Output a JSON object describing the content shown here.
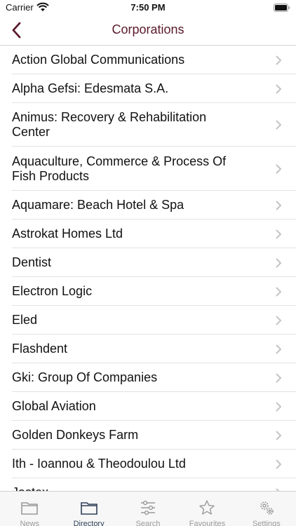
{
  "status_bar": {
    "carrier": "Carrier",
    "time": "7:50 PM"
  },
  "nav": {
    "title": "Corporations",
    "back_icon": "chevron-left-icon",
    "accent_color": "#5a1a2b"
  },
  "list": {
    "items": [
      {
        "label": "Action Global Communications"
      },
      {
        "label": "Alpha Gefsi: Edesmata S.A."
      },
      {
        "label": "Animus: Recovery & Rehabilitation Center"
      },
      {
        "label": "Aquaculture, Commerce & Process Of Fish Products"
      },
      {
        "label": "Aquamare: Beach Hotel & Spa"
      },
      {
        "label": "Astrokat Homes Ltd"
      },
      {
        "label": "Dentist"
      },
      {
        "label": "Electron Logic"
      },
      {
        "label": "Eled"
      },
      {
        "label": "Flashdent"
      },
      {
        "label": "Gki: Group Of Companies"
      },
      {
        "label": "Global Aviation"
      },
      {
        "label": "Golden Donkeys Farm"
      },
      {
        "label": "Ith - Ioannou & Theodoulou Ltd"
      },
      {
        "label": "Jastex"
      }
    ]
  },
  "tab_bar": {
    "active_color": "#2f3f57",
    "inactive_color": "#9a9a9a",
    "tabs": [
      {
        "label": "News",
        "icon": "folder-icon",
        "active": false
      },
      {
        "label": "Directory",
        "icon": "folder-icon",
        "active": true
      },
      {
        "label": "Search",
        "icon": "sliders-icon",
        "active": false
      },
      {
        "label": "Favourites",
        "icon": "star-icon",
        "active": false
      },
      {
        "label": "Settings",
        "icon": "gears-icon",
        "active": false
      }
    ]
  }
}
